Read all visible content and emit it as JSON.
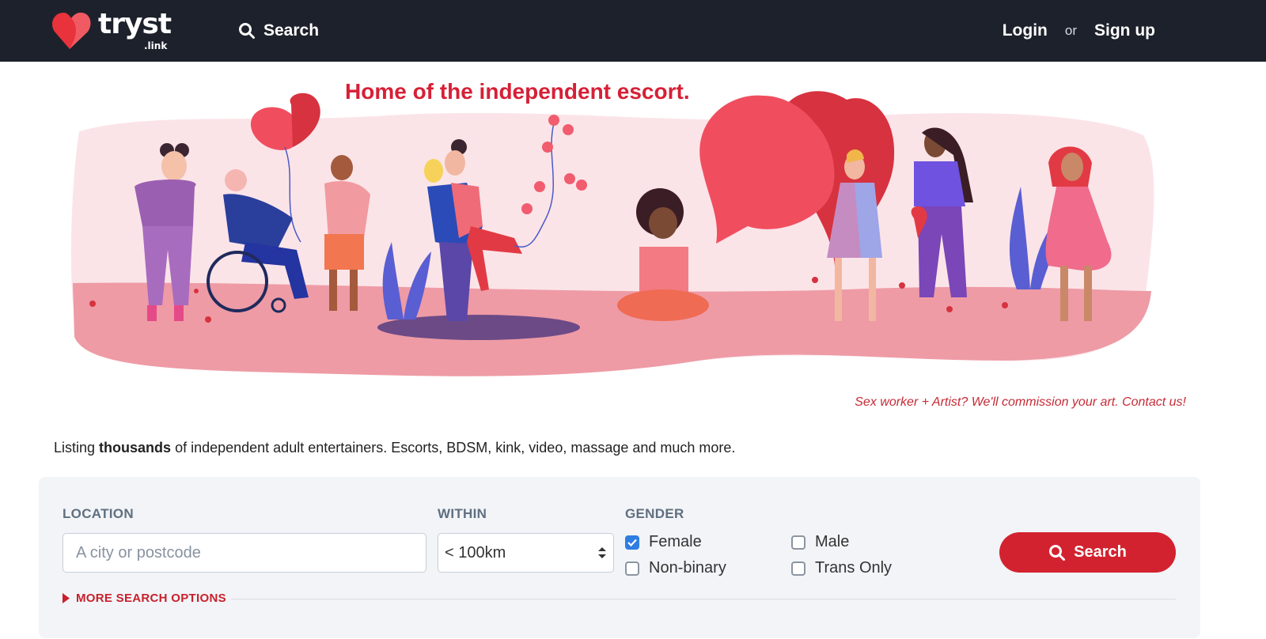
{
  "brand": {
    "name": "tryst",
    "suffix": ".link"
  },
  "header": {
    "search_label": "Search",
    "login_label": "Login",
    "or_label": "or",
    "signup_label": "Sign up"
  },
  "hero": {
    "title": "Home of the independent escort.",
    "credit": "Sex worker + Artist? We'll commission your art. Contact us!"
  },
  "intro": {
    "before": "Listing ",
    "bold": "thousands",
    "after": " of independent adult entertainers. Escorts, BDSM, kink, video, massage and much more."
  },
  "search_form": {
    "location_label": "LOCATION",
    "location_placeholder": "A city or postcode",
    "within_label": "WITHIN",
    "within_value": "< 100km",
    "gender_label": "GENDER",
    "genders": [
      {
        "label": "Female",
        "checked": true
      },
      {
        "label": "Male",
        "checked": false
      },
      {
        "label": "Non-binary",
        "checked": false
      },
      {
        "label": "Trans Only",
        "checked": false
      }
    ],
    "search_button": "Search",
    "more_options": "MORE SEARCH OPTIONS"
  },
  "colors": {
    "header_bg": "#1d212b",
    "brand_red": "#d3222f",
    "hero_pink": "#fbe4e8",
    "checkbox_blue": "#2f7de1"
  }
}
